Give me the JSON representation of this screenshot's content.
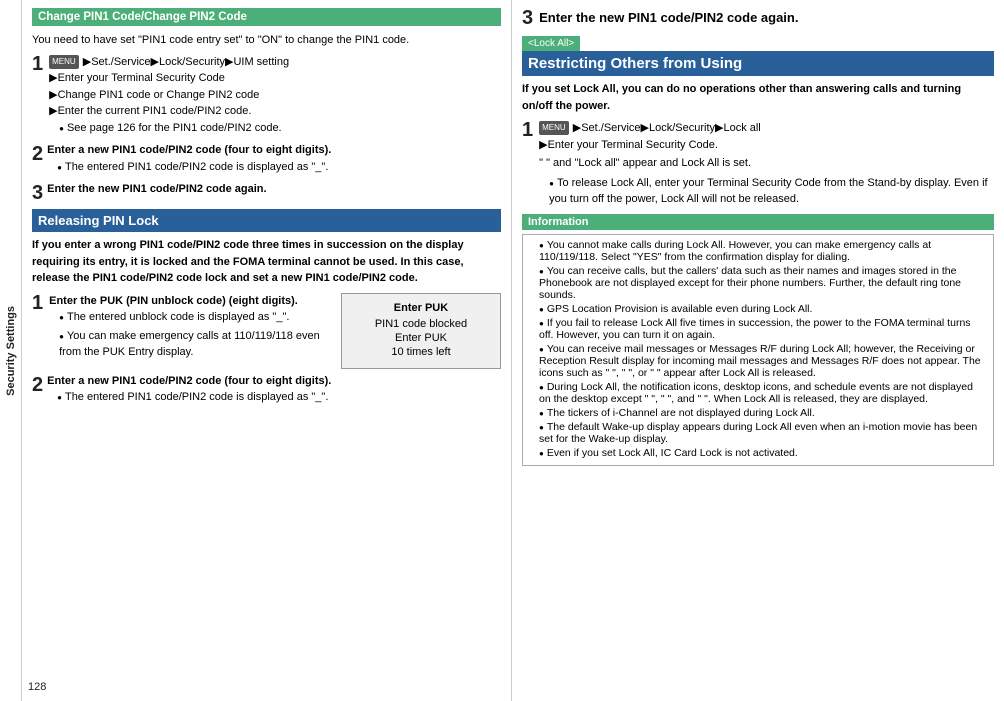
{
  "sidebar": {
    "label": "Security Settings"
  },
  "page_number": "128",
  "left": {
    "section1_title": "Change PIN1 Code/Change PIN2 Code",
    "section1_intro": "You need to have set \"PIN1 code entry set\" to \"ON\" to change the PIN1 code.",
    "step1_content": [
      "▶Set./Service▶Lock/Security▶UIM setting",
      "▶Enter your Terminal Security Code",
      "▶Change PIN1 code or Change PIN2 code",
      "▶Enter the current PIN1 code/PIN2 code."
    ],
    "step1_bullet": "See page 126 for the PIN1 code/PIN2 code.",
    "step2_label": "Enter a new PIN1 code/PIN2 code (four to eight digits).",
    "step2_bullet": "The entered PIN1 code/PIN2 code is displayed as \"_\".",
    "step3_label": "Enter the new PIN1 code/PIN2 code again.",
    "section2_title": "Releasing PIN Lock",
    "section2_intro": "If you enter a wrong PIN1 code/PIN2 code three times in succession on the display requiring its entry, it is locked and the FOMA terminal cannot be used. In this case, release the PIN1 code/PIN2 code lock and set a new PIN1 code/PIN2 code.",
    "rstep1_label": "Enter the PUK (PIN unblock code) (eight digits).",
    "rstep1_bullet1": "The entered unblock code is displayed as \"_\".",
    "rstep1_bullet2": "You can make emergency calls at 110/119/118 even from the PUK Entry display.",
    "puk_box": {
      "title": "Enter PUK",
      "line1": "PIN1 code blocked",
      "line2": "Enter PUK",
      "line3": "10 times left"
    },
    "rstep2_label": "Enter a new PIN1 code/PIN2 code (four to eight digits).",
    "rstep2_bullet": "The entered PIN1 code/PIN2 code is displayed as \"_\".",
    "rstep3_label": "Enter the new PIN1 code/PIN2 code again."
  },
  "right": {
    "step3_bold": "Enter the new PIN1 code/PIN2 code again.",
    "lock_all_tag": "<Lock All>",
    "restricting_title": "Restricting Others from Using",
    "restricting_intro": "If you set Lock All, you can do no operations other than answering calls and turning on/off the power.",
    "lstep1_content": [
      "▶Set./Service▶Lock/Security▶Lock all",
      "▶Enter your Terminal Security Code."
    ],
    "lstep1_quote": "\" \" and \"Lock all\" appear and Lock All is set.",
    "lstep1_bullet": "To release Lock All, enter your Terminal Security Code from the Stand-by display. Even if you turn off the power, Lock All will not be released.",
    "info_header": "Information",
    "info_bullets": [
      "You cannot make calls during Lock All. However, you can make emergency calls at 110/119/118. Select \"YES\" from the confirmation display for dialing.",
      "You can receive calls, but the callers' data such as their names and images stored in the Phonebook are not displayed except for their phone numbers. Further, the default ring tone sounds.",
      "GPS Location Provision is available even during Lock All.",
      "If you fail to release Lock All five times in succession, the power to the FOMA terminal turns off. However, you can turn it on again.",
      "You can receive mail messages or Messages R/F during Lock All; however, the Receiving or Reception Result display for incoming mail messages and Messages R/F does not appear. The icons such as \" \", \" \", or \" \" appear after Lock All is released.",
      "During Lock All, the notification icons, desktop icons, and schedule events are not displayed on the desktop except \" \", \" \", and \" \". When Lock All is released, they are displayed.",
      "The tickers of i-Channel are not displayed during Lock All.",
      "The default Wake-up display appears during Lock All even when an i-motion movie has been set for the Wake-up display.",
      "Even if you set Lock All, IC Card Lock is not activated."
    ]
  }
}
